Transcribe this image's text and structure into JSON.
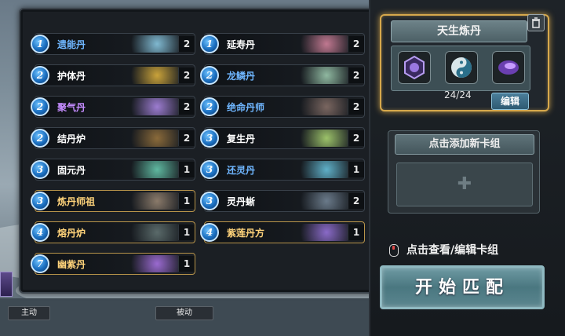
{
  "cards": [
    {
      "cost": "1",
      "name": "遗能丹",
      "count": "2",
      "name_color": "#6fb6ff",
      "art": "#7fb8d0",
      "gold": false
    },
    {
      "cost": "1",
      "name": "延寿丹",
      "count": "2",
      "name_color": "#ffffff",
      "art": "#c07890",
      "gold": false
    },
    {
      "cost": "2",
      "name": "护体丹",
      "count": "2",
      "name_color": "#ffffff",
      "art": "#c9a23a",
      "gold": false
    },
    {
      "cost": "2",
      "name": "龙鳞丹",
      "count": "2",
      "name_color": "#6fb6ff",
      "art": "#8fb8a0",
      "gold": false
    },
    {
      "cost": "2",
      "name": "聚气丹",
      "count": "2",
      "name_color": "#c58cff",
      "art": "#9c7cd0",
      "gold": false
    },
    {
      "cost": "2",
      "name": "绝命丹师",
      "count": "2",
      "name_color": "#6fb6ff",
      "art": "#7a6660",
      "gold": false
    },
    {
      "cost": "2",
      "name": "结丹炉",
      "count": "2",
      "name_color": "#ffffff",
      "art": "#8a6a3a",
      "gold": false
    },
    {
      "cost": "3",
      "name": "复生丹",
      "count": "2",
      "name_color": "#ffffff",
      "art": "#9cc26a",
      "gold": false
    },
    {
      "cost": "3",
      "name": "固元丹",
      "count": "1",
      "name_color": "#ffffff",
      "art": "#5fb8a0",
      "gold": false
    },
    {
      "cost": "3",
      "name": "还灵丹",
      "count": "1",
      "name_color": "#6fb6ff",
      "art": "#5fb0c8",
      "gold": false
    },
    {
      "cost": "3",
      "name": "炼丹师祖",
      "count": "1",
      "name_color": "#ffd37a",
      "art": "#8a7a6a",
      "gold": true
    },
    {
      "cost": "3",
      "name": "灵丹蜥",
      "count": "2",
      "name_color": "#ffffff",
      "art": "#6a7a8a",
      "gold": false
    },
    {
      "cost": "4",
      "name": "熔丹炉",
      "count": "1",
      "name_color": "#ffd37a",
      "art": "#5a6a6a",
      "gold": true
    },
    {
      "cost": "4",
      "name": "紫莲丹方",
      "count": "1",
      "name_color": "#ffd37a",
      "art": "#8a6ac8",
      "gold": true
    },
    {
      "cost": "7",
      "name": "幽紫丹",
      "count": "1",
      "name_color": "#ffd37a",
      "art": "#9a6ad0",
      "gold": true
    }
  ],
  "deck": {
    "title": "天生炼丹",
    "count": "24/24",
    "edit_label": "编辑",
    "icons": [
      "hexagon-crystal-icon",
      "yin-yang-icon",
      "purple-hand-icon"
    ]
  },
  "add_deck": {
    "title": "点击添加新卡组",
    "plus": "✚"
  },
  "view_hint": "点击查看/编辑卡组",
  "start_button": "开始匹配",
  "bottom_labels": {
    "left": "主动",
    "right": "被动"
  },
  "colors": {
    "gold_border": "#d6a84c",
    "accent_blue": "#6fb6ff",
    "legend_gold": "#ffd37a"
  }
}
